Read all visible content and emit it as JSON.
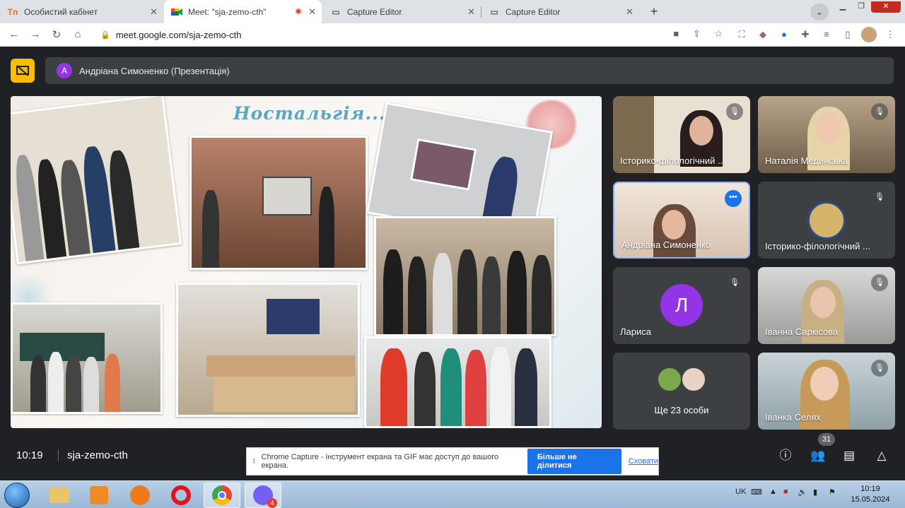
{
  "browser": {
    "tabs": [
      {
        "title": "Особистий кабінет",
        "icon": "tn-logo-icon"
      },
      {
        "title": "Meet: \"sja-zemo-cth\"",
        "icon": "meet-icon"
      },
      {
        "title": "Capture Editor",
        "icon": "page-icon"
      },
      {
        "title": "Capture Editor",
        "icon": "page-icon"
      }
    ],
    "url": "meet.google.com/sja-zemo-cth"
  },
  "meet": {
    "presenter_initial": "A",
    "presenter_label": "Андріана Симоненко (Презентація)",
    "slide_title": "Ностальгія...",
    "participants": [
      {
        "name": "Історико-філологічний ...",
        "muted": true
      },
      {
        "name": "Наталія Мединська",
        "muted": true
      },
      {
        "name": "Андріана Симоненко",
        "muted": false
      },
      {
        "name": "Історико-філологічний ...",
        "muted": true
      },
      {
        "name": "Лариса",
        "initial": "Л",
        "muted": true
      },
      {
        "name": "Іванна Саркісова",
        "muted": true
      },
      {
        "name": "Іванка Селях",
        "muted": true
      }
    ],
    "others_label": "Ще 23 особи",
    "time": "10:19",
    "meeting_code": "sja-zemo-cth",
    "participant_count": "31"
  },
  "capture_notice": {
    "text": "Chrome Capture - інструмент екрана та GIF має доступ до вашого екрана.",
    "stop_button": "Більше не ділитися",
    "hide_link": "Сховати"
  },
  "taskbar": {
    "lang": "UK",
    "clock_time": "10:19",
    "clock_date": "15.05.2024",
    "viber_badge": "4"
  },
  "colors": {
    "accent": "#1a73e8",
    "presenting": "#fbbc04",
    "meet_bg": "#202124",
    "avatar_larysa": "#9334e6"
  }
}
